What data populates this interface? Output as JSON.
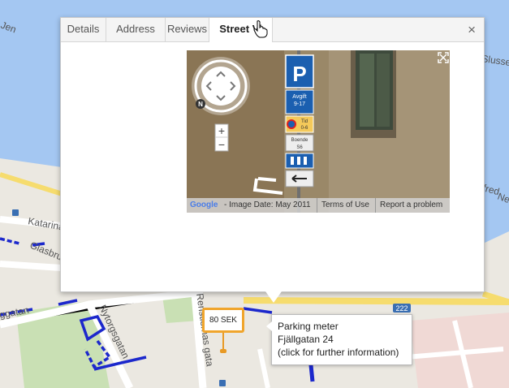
{
  "map": {
    "street_labels": [
      "Katarina",
      "Glasbruk",
      "Nytorgsgatan",
      "Renstiernas gata",
      "ggatan",
      "Slussen",
      "fred",
      "Ne",
      "Jen",
      "222"
    ],
    "colors": {
      "water": "#a4c7f2",
      "land": "#ebe8e1",
      "road": "#ffffff",
      "major_road": "#f6dc6e",
      "route": "#1c28cc",
      "park": "#c9e0b4"
    }
  },
  "popup": {
    "tabs": [
      {
        "label": "Details",
        "active": false
      },
      {
        "label": "Address",
        "active": false
      },
      {
        "label": "Reviews",
        "active": false
      },
      {
        "label": "Street Vi",
        "active": true
      }
    ],
    "close_label": "×",
    "street_view": {
      "footer": {
        "google": "Google",
        "image_date": "- Image Date: May 2011",
        "terms": "Terms of Use",
        "report": "Report a problem"
      },
      "zoom_in": "+",
      "zoom_out": "−",
      "compass_label": "N",
      "signs": {
        "p": "P",
        "avgift": "Avgift",
        "avgift_hours": "9-17",
        "tid": "Tid",
        "tid_hours": "0-6",
        "boende": "Boende",
        "boende_code": "S6"
      }
    }
  },
  "marker": {
    "price": "80 SEK"
  },
  "infobox": {
    "title": "Parking meter",
    "address": "Fjällgatan 24",
    "hint": "(click for further information)"
  }
}
